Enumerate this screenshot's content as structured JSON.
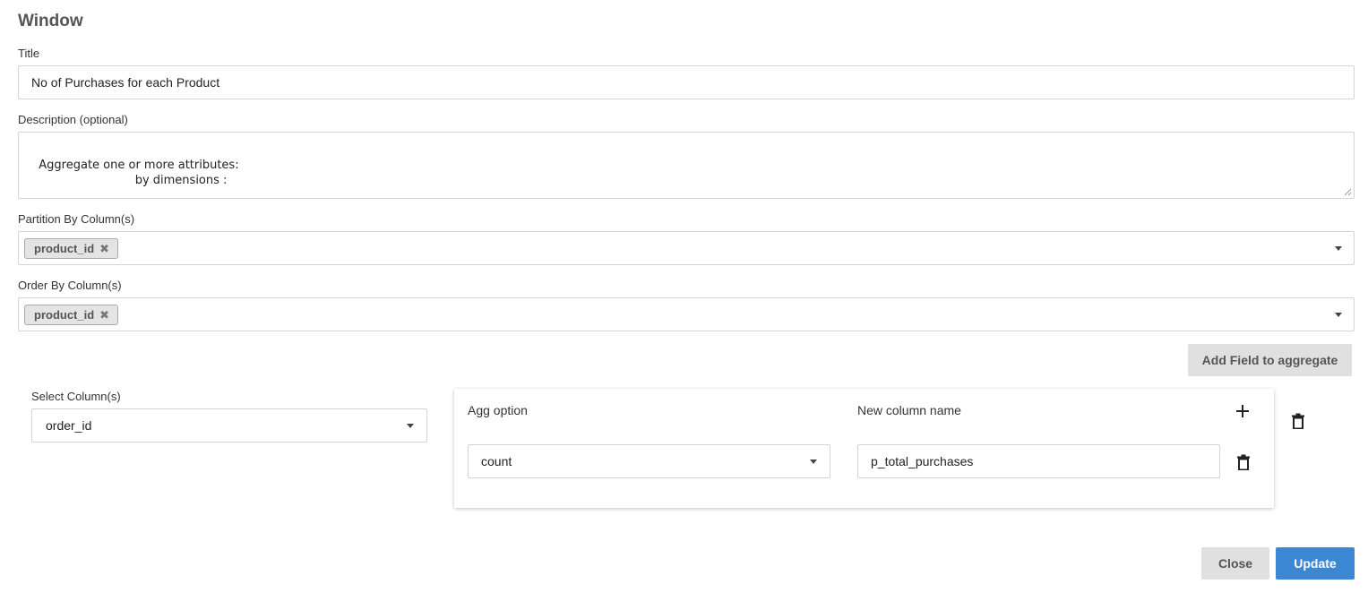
{
  "window": {
    "title": "Window"
  },
  "form": {
    "title_label": "Title",
    "title_value": "No of Purchases for each Product",
    "description_label": "Description (optional)",
    "description_value": "Aggregate one or more attributes:\n                            by dimensions :",
    "partition_label": "Partition By Column(s)",
    "partition_tags": [
      "product_id"
    ],
    "order_label": "Order By Column(s)",
    "order_tags": [
      "product_id"
    ]
  },
  "aggregate": {
    "add_field_label": "Add Field to aggregate",
    "select_columns_label": "Select Column(s)",
    "select_columns_value": "order_id",
    "agg_option_label": "Agg option",
    "new_column_label": "New column name",
    "agg_option_value": "count",
    "new_column_value": "p_total_purchases"
  },
  "icons": {
    "remove_tag": "close-icon",
    "dropdown": "caret-down-icon",
    "add": "plus-icon",
    "delete": "trash-icon"
  },
  "footer": {
    "close_label": "Close",
    "update_label": "Update"
  },
  "colors": {
    "primary": "#3b87d4",
    "secondary": "#e0e0e0"
  }
}
